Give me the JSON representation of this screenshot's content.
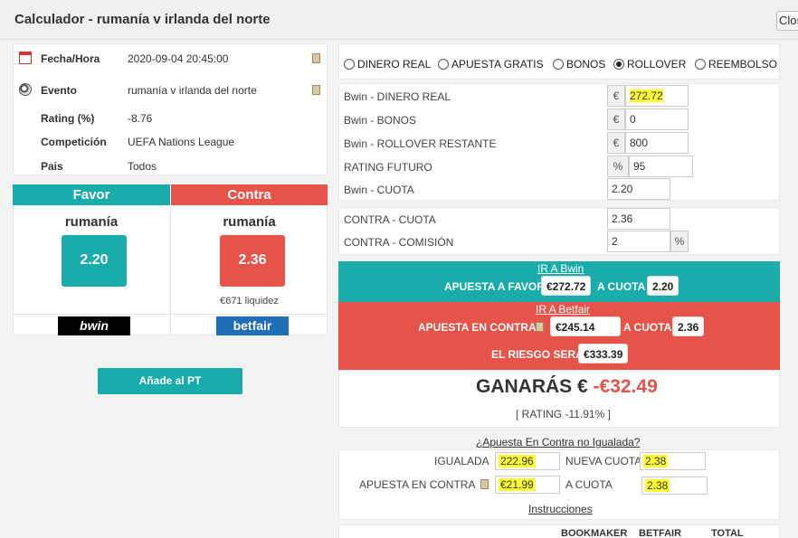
{
  "window": {
    "title": "Calculador - rumanía v irlanda del norte",
    "close_label": "Close"
  },
  "info": {
    "rows": [
      {
        "label": "Fecha/Hora",
        "value": "2020-09-04 20:45:00"
      },
      {
        "label": "Evento",
        "value": "rumanía v irlanda del norte"
      },
      {
        "label": "Rating (%)",
        "value": "-8.76"
      },
      {
        "label": "Competición",
        "value": "UEFA Nations League"
      },
      {
        "label": "Pais",
        "value": "Todos"
      }
    ]
  },
  "favor": {
    "header": "Favor",
    "team": "rumanía",
    "odds": "2.20",
    "bookmaker": "bwin",
    "color": "#1aabab"
  },
  "contra": {
    "header": "Contra",
    "team": "rumanía",
    "odds": "2.36",
    "liquidity": "€671 liquidez",
    "exchange": "betfair",
    "color": "#e55349"
  },
  "add_pt_button": "Añade al PT",
  "modes": [
    "DINERO REAL",
    "APUESTA GRATIS",
    "BONOS",
    "ROLLOVER",
    "REEMBOLSO"
  ],
  "selected_mode": "ROLLOVER",
  "bookmaker_fields": [
    {
      "label": "Bwin - DINERO REAL",
      "addon": "€",
      "value": "272.72"
    },
    {
      "label": "Bwin - BONOS",
      "addon": "€",
      "value": "0"
    },
    {
      "label": "Bwin - ROLLOVER RESTANTE",
      "addon": "€",
      "value": "800"
    },
    {
      "label": "RATING FUTURO",
      "addon": "%",
      "value": "95"
    },
    {
      "label": "Bwin - CUOTA",
      "addon": "",
      "value": "2.20"
    }
  ],
  "exchange_fields": [
    {
      "label": "CONTRA - CUOTA",
      "value": "2.36",
      "addon": ""
    },
    {
      "label": "CONTRA - COMISIÓN",
      "value": "2",
      "addon": "%"
    }
  ],
  "result": {
    "link_bookmaker": "IR A Bwin",
    "favor_label": "APUESTA A FAVOR",
    "favor_stake": "€272.72",
    "favor_cuota_label": "A CUOTA",
    "favor_cuota": "2.20",
    "link_exchange": "IR A Betfair",
    "contra_label": "APUESTA EN CONTRA",
    "contra_stake": "€245.14",
    "contra_cuota_label": "A CUOTA",
    "contra_cuota": "2.36",
    "riesgo_label": "EL RIESGO SERÁ",
    "riesgo": "€333.39",
    "ganaras_label": "GANARÁS €",
    "ganaras_value": "-€32.49",
    "rating_line": "[ RATING -11.91% ]"
  },
  "unmatched": {
    "link": "¿Apuesta En Contra no Igualada?",
    "igualada_label": "IGUALADA",
    "igualada_value": "222.96",
    "nueva_cuota_label": "NUEVA CUOTA",
    "nueva_cuota_value": "2.38",
    "apuesta_contra_label": "APUESTA EN CONTRA",
    "apuesta_contra_value": "€21.99",
    "a_cuota_label": "A CUOTA",
    "a_cuota_value": "2.38",
    "instrucciones": "Instrucciones"
  },
  "table_headers": [
    "BOOKMAKER",
    "BETFAIR",
    "TOTAL"
  ]
}
